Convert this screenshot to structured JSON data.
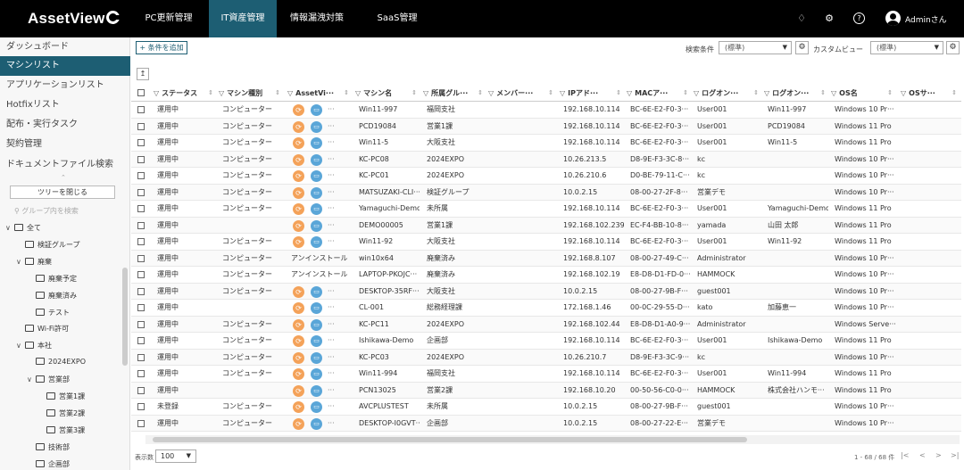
{
  "app": {
    "logo": "AssetView",
    "user": "Adminさん"
  },
  "nav_tabs": [
    {
      "label": "PC更新管理"
    },
    {
      "label": "IT資産管理"
    },
    {
      "label": "情報漏洩対策"
    },
    {
      "label": "SaaS管理"
    }
  ],
  "sidebar": {
    "items": [
      {
        "label": "ダッシュボード"
      },
      {
        "label": "マシンリスト"
      },
      {
        "label": "アプリケーションリスト"
      },
      {
        "label": "Hotfixリスト"
      },
      {
        "label": "配布・実行タスク"
      },
      {
        "label": "契約管理"
      },
      {
        "label": "ドキュメントファイル検索"
      }
    ],
    "collapse_label": "ツリーを閉じる",
    "search_placeholder": "グループ内を検索",
    "tree": [
      {
        "label": "全て",
        "level": 0,
        "expand": "v"
      },
      {
        "label": "検証グループ",
        "level": 1,
        "expand": ""
      },
      {
        "label": "廃棄",
        "level": 1,
        "expand": "v"
      },
      {
        "label": "廃棄予定",
        "level": 2,
        "expand": ""
      },
      {
        "label": "廃棄済み",
        "level": 2,
        "expand": ""
      },
      {
        "label": "テスト",
        "level": 2,
        "expand": ""
      },
      {
        "label": "Wi-Fi許可",
        "level": 1,
        "expand": ""
      },
      {
        "label": "本社",
        "level": 1,
        "expand": "v"
      },
      {
        "label": "2024EXPO",
        "level": 2,
        "expand": ""
      },
      {
        "label": "営業部",
        "level": 2,
        "expand": "v"
      },
      {
        "label": "営業1課",
        "level": 3,
        "expand": ""
      },
      {
        "label": "営業2課",
        "level": 3,
        "expand": ""
      },
      {
        "label": "営業3課",
        "level": 3,
        "expand": ""
      },
      {
        "label": "技術部",
        "level": 2,
        "expand": ""
      },
      {
        "label": "企画部",
        "level": 2,
        "expand": ""
      }
    ]
  },
  "toolbar": {
    "add_condition": "+ 条件を追加",
    "search_condition_label": "検索条件",
    "search_condition_value": "(標準)",
    "custom_view_label": "カスタムビュー",
    "custom_view_value": "(標準)"
  },
  "table": {
    "headers": [
      "ステータス",
      "マシン種別",
      "AssetVi···",
      "マシン名",
      "所属グル···",
      "メンバー···",
      "IPアド···",
      "MACア···",
      "ログオン···",
      "ログオン···",
      "OS名",
      "OSサ···"
    ],
    "rows": [
      [
        "運用中",
        "コンピューター",
        "icons",
        "Win11-997",
        "福岡支社",
        "",
        "192.168.10.114",
        "BC-6E-E2-F0-3···",
        "User001",
        "Win11-997",
        "Windows 10 Pr···"
      ],
      [
        "運用中",
        "コンピューター",
        "icons",
        "PCD19084",
        "営業1課",
        "",
        "192.168.10.114",
        "BC-6E-E2-F0-3···",
        "User001",
        "PCD19084",
        "Windows 11 Pro"
      ],
      [
        "運用中",
        "コンピューター",
        "icons",
        "Win11-5",
        "大阪支社",
        "",
        "192.168.10.114",
        "BC-6E-E2-F0-3···",
        "User001",
        "Win11-5",
        "Windows 11 Pro"
      ],
      [
        "運用中",
        "コンピューター",
        "icons",
        "KC-PC08",
        "2024EXPO",
        "",
        "10.26.213.5",
        "D8-9E-F3-3C-8···",
        "kc",
        "",
        "Windows 10 Pr···"
      ],
      [
        "運用中",
        "コンピューター",
        "icons",
        "KC-PC01",
        "2024EXPO",
        "",
        "10.26.210.6",
        "D0-BE-79-11-C···",
        "kc",
        "",
        "Windows 10 Pr···"
      ],
      [
        "運用中",
        "コンピューター",
        "icons",
        "MATSUZAKI-CLI···",
        "検証グループ",
        "",
        "10.0.2.15",
        "08-00-27-2F-8···",
        "営業デモ",
        "",
        "Windows 10 Pr···"
      ],
      [
        "運用中",
        "コンピューター",
        "icons",
        "Yamaguchi-Demo",
        "未所属",
        "",
        "192.168.10.114",
        "BC-6E-E2-F0-3···",
        "User001",
        "Yamaguchi-Demo",
        "Windows 11 Pro"
      ],
      [
        "運用中",
        "",
        "icons",
        "DEMO00005",
        "営業1課",
        "",
        "192.168.102.239",
        "EC-F4-BB-10-8···",
        "yamada",
        "山田 太郎",
        "Windows 11 Pro"
      ],
      [
        "運用中",
        "コンピューター",
        "icons",
        "Win11-92",
        "大阪支社",
        "",
        "192.168.10.114",
        "BC-6E-E2-F0-3···",
        "User001",
        "Win11-92",
        "Windows 11 Pro"
      ],
      [
        "運用中",
        "コンピューター",
        "アンインストール",
        "win10x64",
        "廃棄済み",
        "",
        "192.168.8.107",
        "08-00-27-49-C···",
        "Administrator",
        "",
        "Windows 10 Pr···"
      ],
      [
        "運用中",
        "コンピューター",
        "アンインストール",
        "LAPTOP-PKOJC···",
        "廃棄済み",
        "",
        "192.168.102.19",
        "E8-D8-D1-FD-0···",
        "HAMMOCK",
        "",
        "Windows 10 Pr···"
      ],
      [
        "運用中",
        "コンピューター",
        "icons",
        "DESKTOP-35RF···",
        "大阪支社",
        "",
        "10.0.2.15",
        "08-00-27-9B-F···",
        "guest001",
        "",
        "Windows 10 Pr···"
      ],
      [
        "運用中",
        "",
        "icons",
        "CL-001",
        "総務経理課",
        "",
        "172.168.1.46",
        "00-0C-29-55-D···",
        "kato",
        "加藤恵一",
        "Windows 10 Pr···"
      ],
      [
        "運用中",
        "コンピューター",
        "icons",
        "KC-PC11",
        "2024EXPO",
        "",
        "192.168.102.44",
        "E8-D8-D1-A0-9···",
        "Administrator",
        "",
        "Windows Serve···"
      ],
      [
        "運用中",
        "コンピューター",
        "icons",
        "Ishikawa-Demo",
        "企画部",
        "",
        "192.168.10.114",
        "BC-6E-E2-F0-3···",
        "User001",
        "Ishikawa-Demo",
        "Windows 11 Pro"
      ],
      [
        "運用中",
        "コンピューター",
        "icons",
        "KC-PC03",
        "2024EXPO",
        "",
        "10.26.210.7",
        "D8-9E-F3-3C-9···",
        "kc",
        "",
        "Windows 10 Pr···"
      ],
      [
        "運用中",
        "コンピューター",
        "icons",
        "Win11-994",
        "福岡支社",
        "",
        "192.168.10.114",
        "BC-6E-E2-F0-3···",
        "User001",
        "Win11-994",
        "Windows 11 Pro"
      ],
      [
        "運用中",
        "",
        "icons",
        "PCN13025",
        "営業2課",
        "",
        "192.168.10.20",
        "00-50-56-C0-0···",
        "HAMMOCK",
        "株式会社ハンモ···",
        "Windows 11 Pro"
      ],
      [
        "未登録",
        "コンピューター",
        "icons",
        "AVCPLUSTEST",
        "未所属",
        "",
        "10.0.2.15",
        "08-00-27-9B-F···",
        "guest001",
        "",
        "Windows 10 Pr···"
      ],
      [
        "運用中",
        "コンピューター",
        "icons",
        "DESKTOP-I0GVT···",
        "企画部",
        "",
        "10.0.2.15",
        "08-00-27-22-E···",
        "営業デモ",
        "",
        "Windows 10 Pr···"
      ]
    ]
  },
  "footer": {
    "page_size_label": "表示数",
    "page_size": "100",
    "page_info": "1 - 68 / 68 件",
    "nav_first": "|<",
    "nav_prev": "<",
    "nav_next": ">",
    "nav_last": ">|"
  },
  "icons": {
    "asset_sync": "refresh-icon",
    "asset_screen": "monitor-icon"
  },
  "colors": {
    "accent": "#1d5e73",
    "topbar": "#000000",
    "icon_orange": "#f4a259",
    "icon_blue": "#5aa6d8"
  }
}
